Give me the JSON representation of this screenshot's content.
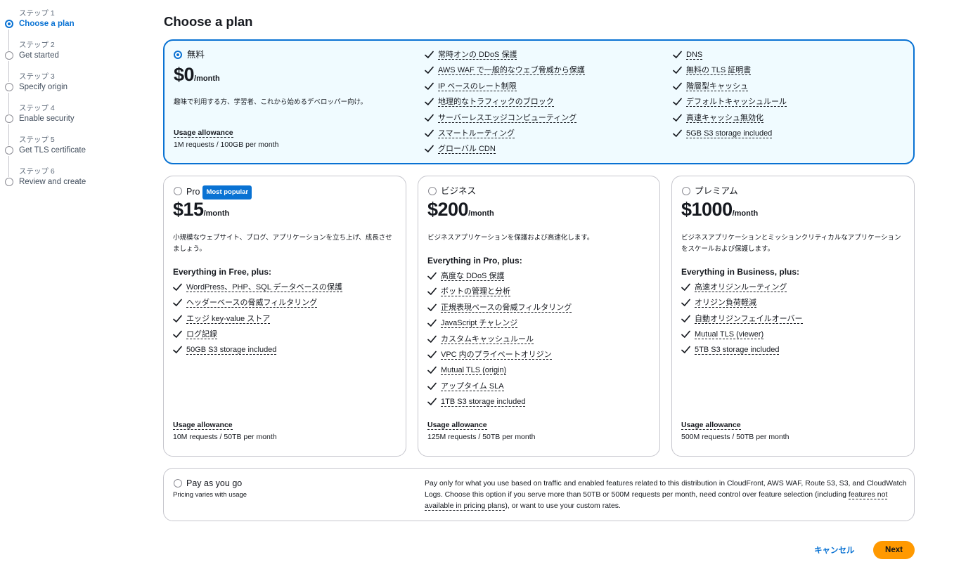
{
  "steps": [
    {
      "num": "ステップ 1",
      "label": "Choose a plan"
    },
    {
      "num": "ステップ 2",
      "label": "Get started"
    },
    {
      "num": "ステップ 3",
      "label": "Specify origin"
    },
    {
      "num": "ステップ 4",
      "label": "Enable security"
    },
    {
      "num": "ステップ 5",
      "label": "Get TLS certificate"
    },
    {
      "num": "ステップ 6",
      "label": "Review and create"
    }
  ],
  "page_title": "Choose a plan",
  "free": {
    "name": "無料",
    "price": "$0",
    "per": "/month",
    "desc": "趣味で利用する方、学習者、これから始めるデベロッパー向け。",
    "features_col1": [
      "常時オンの DDoS 保護",
      "AWS WAF で一般的なウェブ脅威から保護",
      "IP ベースのレート制限",
      "地理的なトラフィックのブロック",
      "サーバーレスエッジコンピューティング",
      "スマートルーティング",
      "グローバル CDN"
    ],
    "features_col2": [
      "DNS",
      "無料の TLS 証明書",
      "階層型キャッシュ",
      "デフォルトキャッシュルール",
      "高速キャッシュ無効化",
      "5GB S3 storage included"
    ],
    "usage_label": "Usage allowance",
    "usage_value": "1M requests / 100GB per month"
  },
  "pro": {
    "name": "Pro",
    "badge": "Most popular",
    "price": "$15",
    "per": "/month",
    "desc": "小規模なウェブサイト、ブログ、アプリケーションを立ち上げ、成長させましょう。",
    "includes": "Everything in Free, plus:",
    "features": [
      "WordPress、PHP、SQL データベースの保護",
      "ヘッダーベースの脅威フィルタリング",
      "エッジ key-value ストア",
      "ログ記録",
      "50GB S3 storage included"
    ],
    "usage_label": "Usage allowance",
    "usage_value": "10M requests / 50TB per month"
  },
  "business": {
    "name": "ビジネス",
    "price": "$200",
    "per": "/month",
    "desc": "ビジネスアプリケーションを保護および高速化します。",
    "includes": "Everything in Pro, plus:",
    "features": [
      "高度な DDoS 保護",
      "ボットの管理と分析",
      "正規表現ベースの脅威フィルタリング",
      "JavaScript チャレンジ",
      "カスタムキャッシュルール",
      "VPC 内のプライベートオリジン",
      "Mutual TLS (origin)",
      "アップタイム SLA",
      "1TB S3 storage included"
    ],
    "usage_label": "Usage allowance",
    "usage_value": "125M requests / 50TB per month"
  },
  "premium": {
    "name": "プレミアム",
    "price": "$1000",
    "per": "/month",
    "desc": "ビジネスアプリケーションとミッションクリティカルなアプリケーションをスケールおよび保護します。",
    "includes": "Everything in Business, plus:",
    "features": [
      "高速オリジンルーティング",
      "オリジン負荷軽減",
      "自動オリジンフェイルオーバー",
      "Mutual TLS (viewer)",
      "5TB S3 storage included"
    ],
    "usage_label": "Usage allowance",
    "usage_value": "500M requests / 50TB per month"
  },
  "payg": {
    "name": "Pay as you go",
    "sub": "Pricing varies with usage",
    "text_before": "Pay only for what you use based on traffic and enabled features related to this distribution in CloudFront, AWS WAF, Route 53, S3, and CloudWatch Logs. Choose this option if you serve more than 50TB or 500M requests per month, need control over feature selection (including ",
    "link": "features not available in pricing plans",
    "text_after": "), or want to use your custom rates."
  },
  "buttons": {
    "cancel": "キャンセル",
    "next": "Next"
  },
  "colors": {
    "accent": "#0972d3",
    "next_button": "#ff9900",
    "selected_card_bg": "#f0fbff"
  }
}
